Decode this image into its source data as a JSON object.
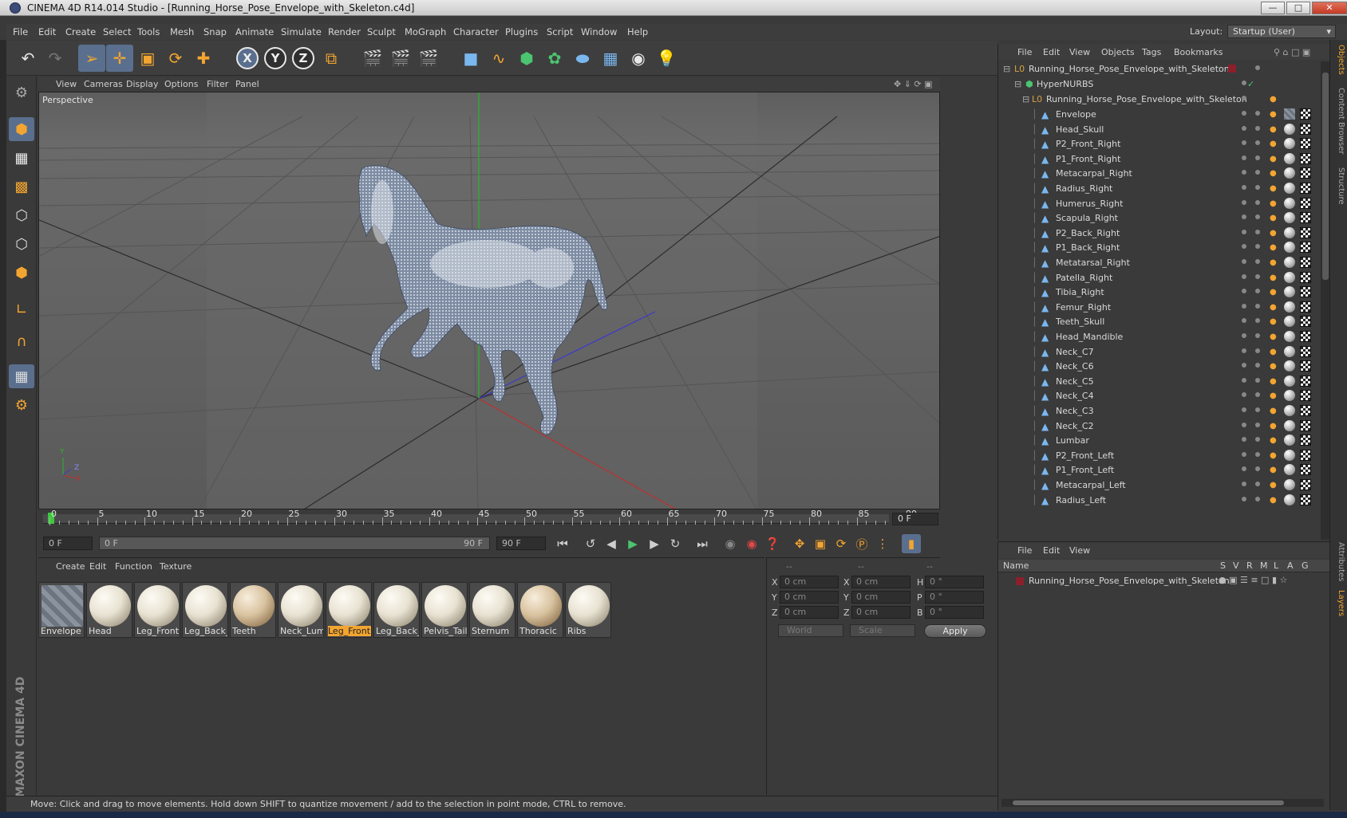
{
  "window": {
    "title": "CINEMA 4D R14.014 Studio - [Running_Horse_Pose_Envelope_with_Skeleton.c4d]",
    "minimize": "—",
    "maximize": "□",
    "close": "✕"
  },
  "menu": [
    "File",
    "Edit",
    "Create",
    "Select",
    "Tools",
    "Mesh",
    "Snap",
    "Animate",
    "Simulate",
    "Render",
    "Sculpt",
    "MoGraph",
    "Character",
    "Plugins",
    "Script",
    "Window",
    "Help"
  ],
  "layout": {
    "label": "Layout:",
    "value": "Startup (User)"
  },
  "toolbar": {
    "icons": [
      "undo-icon",
      "redo-icon",
      "live-select-icon",
      "move-icon",
      "scale-icon",
      "rotate-icon",
      "recent-tool-icon",
      "x-axis-icon",
      "y-axis-icon",
      "z-axis-icon",
      "coordinate-system-icon",
      "render-view-icon",
      "render-picture-viewer-icon",
      "edit-render-settings-icon",
      "cube-icon",
      "spline-icon",
      "nurbs-icon",
      "array-icon",
      "deformer-icon",
      "floor-icon",
      "camera-icon",
      "light-icon"
    ],
    "axis_labels": [
      "X",
      "Y",
      "Z"
    ]
  },
  "viewport": {
    "menu": [
      "View",
      "Cameras",
      "Display",
      "Options",
      "Filter",
      "Panel"
    ],
    "label": "Perspective",
    "axis_labels": [
      "Y",
      "X",
      "Z"
    ]
  },
  "timeline": {
    "ticks": [
      "0",
      "5",
      "10",
      "15",
      "20",
      "25",
      "30",
      "35",
      "40",
      "45",
      "50",
      "55",
      "60",
      "65",
      "70",
      "75",
      "80",
      "85",
      "90"
    ],
    "current_frame": "0 F"
  },
  "transport": {
    "start": "0 F",
    "range_start": "0 F",
    "range_end": "90 F",
    "end": "90 F"
  },
  "materials": {
    "menu": [
      "Create",
      "Edit",
      "Function",
      "Texture"
    ],
    "items": [
      "Envelope",
      "Head",
      "Leg_Front",
      "Leg_Back_F",
      "Teeth",
      "Neck_Lumb",
      "Leg_Front",
      "Leg_Back_L",
      "Pelvis_Tail",
      "Sternum",
      "Thoracic",
      "Ribs"
    ],
    "selected_index": 6
  },
  "coordinates": {
    "headers": [
      "--",
      "--",
      "--"
    ],
    "rows": [
      {
        "l1": "X",
        "v1": "0 cm",
        "l2": "X",
        "v2": "0 cm",
        "l3": "H",
        "v3": "0 °"
      },
      {
        "l1": "Y",
        "v1": "0 cm",
        "l2": "Y",
        "v2": "0 cm",
        "l3": "P",
        "v3": "0 °"
      },
      {
        "l1": "Z",
        "v1": "0 cm",
        "l2": "Z",
        "v2": "0 cm",
        "l3": "B",
        "v3": "0 °"
      }
    ],
    "mode": "World",
    "size_mode": "Scale",
    "apply": "Apply"
  },
  "status": "Move: Click and drag to move elements. Hold down SHIFT to quantize movement / add to the selection in point mode, CTRL to remove.",
  "objects": {
    "menu": [
      "File",
      "Edit",
      "View",
      "Objects",
      "Tags",
      "Bookmarks"
    ],
    "root": "Running_Horse_Pose_Envelope_with_Skeleton",
    "hypernurbs": "HyperNURBS",
    "child": "Running_Horse_Pose_Envelope_with_Skeleton",
    "bones": [
      "Envelope",
      "Head_Skull",
      "P2_Front_Right",
      "P1_Front_Right",
      "Metacarpal_Right",
      "Radius_Right",
      "Humerus_Right",
      "Scapula_Right",
      "P2_Back_Right",
      "P1_Back_Right",
      "Metatarsal_Right",
      "Patella_Right",
      "Tibia_Right",
      "Femur_Right",
      "Teeth_Skull",
      "Head_Mandible",
      "Neck_C7",
      "Neck_C6",
      "Neck_C5",
      "Neck_C4",
      "Neck_C3",
      "Neck_C2",
      "Lumbar",
      "P2_Front_Left",
      "P1_Front_Left",
      "Metacarpal_Left",
      "Radius_Left"
    ]
  },
  "layers": {
    "menu": [
      "File",
      "Edit",
      "View"
    ],
    "columns": [
      "Name",
      "S",
      "V",
      "R",
      "M",
      "L",
      "A",
      "G"
    ],
    "row": "Running_Horse_Pose_Envelope_with_Skeleton"
  },
  "right_tabs": [
    "Objects",
    "Content Browser",
    "Structure",
    "Attributes",
    "Layers"
  ],
  "brand": "MAXON CINEMA 4D",
  "colors": {
    "accent": "#f3a531",
    "selection": "#5a6f8e",
    "bone": "#7ab7ee"
  }
}
